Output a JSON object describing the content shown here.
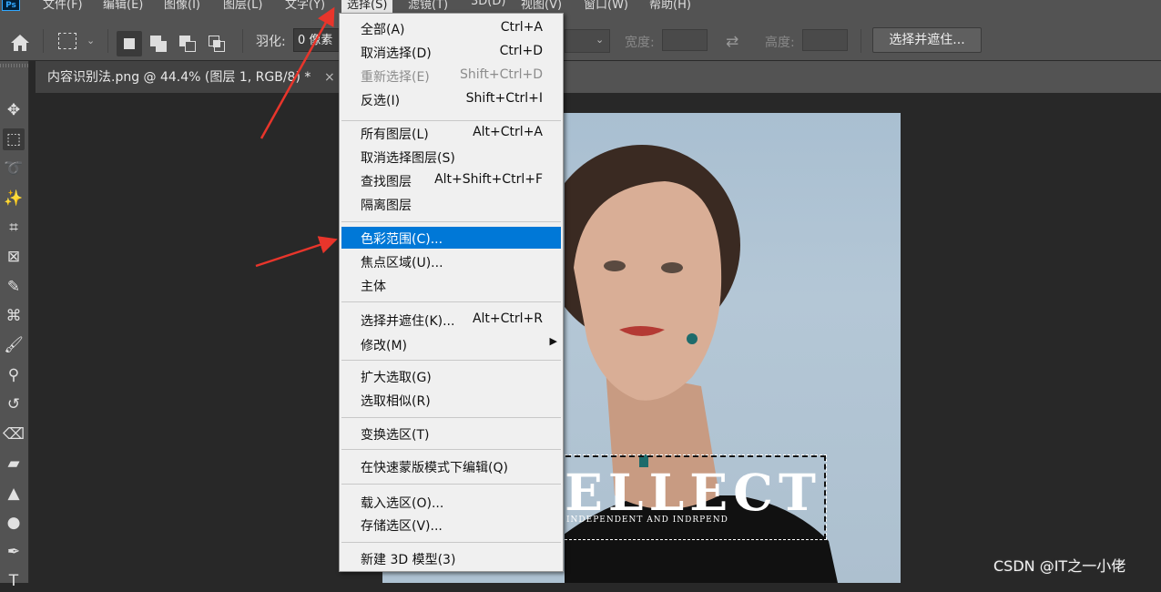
{
  "menubar": {
    "logo": "Ps",
    "items": [
      {
        "label": "文件(F)"
      },
      {
        "label": "编辑(E)"
      },
      {
        "label": "图像(I)"
      },
      {
        "label": "图层(L)"
      },
      {
        "label": "文字(Y)"
      },
      {
        "label": "选择(S)"
      },
      {
        "label": "滤镜(T)"
      },
      {
        "label": "3D(D)"
      },
      {
        "label": "视图(V)"
      },
      {
        "label": "窗口(W)"
      },
      {
        "label": "帮助(H)"
      }
    ]
  },
  "options": {
    "feather_label": "羽化:",
    "feather_value": "0 像素",
    "width_label": "宽度:",
    "height_label": "高度:",
    "select_and_mask": "选择并遮住..."
  },
  "document": {
    "tab_title": "内容识别法.png @ 44.4% (图层 1, RGB/8) *",
    "close": "×"
  },
  "image": {
    "headline": "ELLECT",
    "tagline": "INDEPENDENT AND INDRPEND"
  },
  "select_menu": {
    "items": [
      {
        "label": "全部(A)",
        "shortcut": "Ctrl+A"
      },
      {
        "label": "取消选择(D)",
        "shortcut": "Ctrl+D"
      },
      {
        "label": "重新选择(E)",
        "shortcut": "Shift+Ctrl+D",
        "disabled": true
      },
      {
        "label": "反选(I)",
        "shortcut": "Shift+Ctrl+I"
      },
      {
        "label": "所有图层(L)",
        "shortcut": "Alt+Ctrl+A"
      },
      {
        "label": "取消选择图层(S)",
        "shortcut": ""
      },
      {
        "label": "查找图层",
        "shortcut": "Alt+Shift+Ctrl+F"
      },
      {
        "label": "隔离图层",
        "shortcut": ""
      },
      {
        "label": "色彩范围(C)...",
        "shortcut": "",
        "highlighted": true
      },
      {
        "label": "焦点区域(U)...",
        "shortcut": ""
      },
      {
        "label": "主体",
        "shortcut": ""
      },
      {
        "label": "选择并遮住(K)...",
        "shortcut": "Alt+Ctrl+R"
      },
      {
        "label": "修改(M)",
        "shortcut": "",
        "submenu": true
      },
      {
        "label": "扩大选取(G)",
        "shortcut": ""
      },
      {
        "label": "选取相似(R)",
        "shortcut": ""
      },
      {
        "label": "变换选区(T)",
        "shortcut": ""
      },
      {
        "label": "在快速蒙版模式下编辑(Q)",
        "shortcut": ""
      },
      {
        "label": "载入选区(O)...",
        "shortcut": ""
      },
      {
        "label": "存储选区(V)...",
        "shortcut": ""
      },
      {
        "label": "新建 3D 模型(3)",
        "shortcut": ""
      }
    ]
  },
  "tools": [
    {
      "name": "move-tool-icon",
      "glyph": "✥"
    },
    {
      "name": "rect-marquee-tool-icon",
      "glyph": "⬚"
    },
    {
      "name": "lasso-tool-icon",
      "glyph": "➰"
    },
    {
      "name": "magic-wand-tool-icon",
      "glyph": "✨"
    },
    {
      "name": "crop-tool-icon",
      "glyph": "⌗"
    },
    {
      "name": "frame-tool-icon",
      "glyph": "⊠"
    },
    {
      "name": "eyedropper-tool-icon",
      "glyph": "✎"
    },
    {
      "name": "healing-brush-tool-icon",
      "glyph": "⌘"
    },
    {
      "name": "brush-tool-icon",
      "glyph": "🖌"
    },
    {
      "name": "stamp-tool-icon",
      "glyph": "⚲"
    },
    {
      "name": "history-brush-tool-icon",
      "glyph": "↺"
    },
    {
      "name": "eraser-tool-icon",
      "glyph": "⌫"
    },
    {
      "name": "gradient-tool-icon",
      "glyph": "▰"
    },
    {
      "name": "blur-tool-icon",
      "glyph": "▲"
    },
    {
      "name": "dodge-tool-icon",
      "glyph": "●"
    },
    {
      "name": "pen-tool-icon",
      "glyph": "✒"
    },
    {
      "name": "type-tool-icon",
      "glyph": "T"
    }
  ],
  "watermark": "CSDN @IT之一小佬",
  "colors": {
    "menu_highlight": "#0078d7",
    "annotation_arrow": "#e8352b"
  }
}
